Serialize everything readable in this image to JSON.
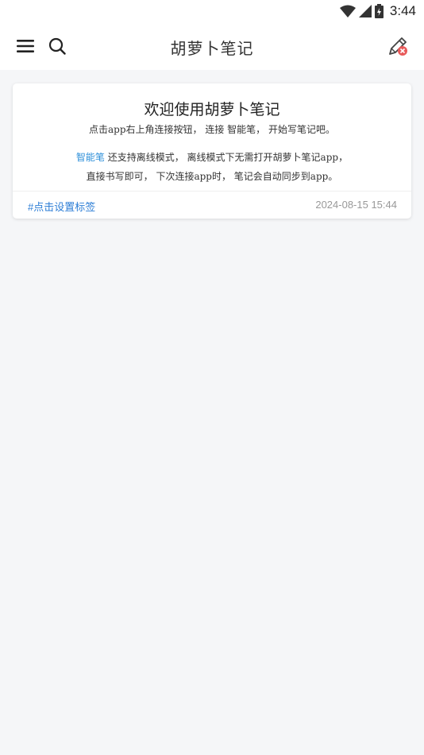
{
  "status_bar": {
    "time": "3:44",
    "icons": [
      "wifi-icon",
      "cell-signal-icon",
      "battery-icon"
    ]
  },
  "header": {
    "title": "胡萝卜笔记",
    "left_icons": [
      "menu-icon",
      "search-icon"
    ],
    "right_icon": "edit-pen-icon",
    "accent_color": "#e85a5a"
  },
  "note_card": {
    "title": "欢迎使用胡萝卜笔记",
    "line1": "点击app右上角连接按钮， 连接 智能笔， 开始写笔记吧。",
    "line2_prefix": "智能笔",
    "line2_rest": " 还支持离线模式， 离线模式下无需打开胡萝卜笔记app，",
    "line3": "直接书写即可， 下次连接app时， 笔记会自动同步到app。",
    "tag": "#点击设置标签",
    "date": "2024-08-15 15:44",
    "highlight_color": "#2d8fd9"
  }
}
